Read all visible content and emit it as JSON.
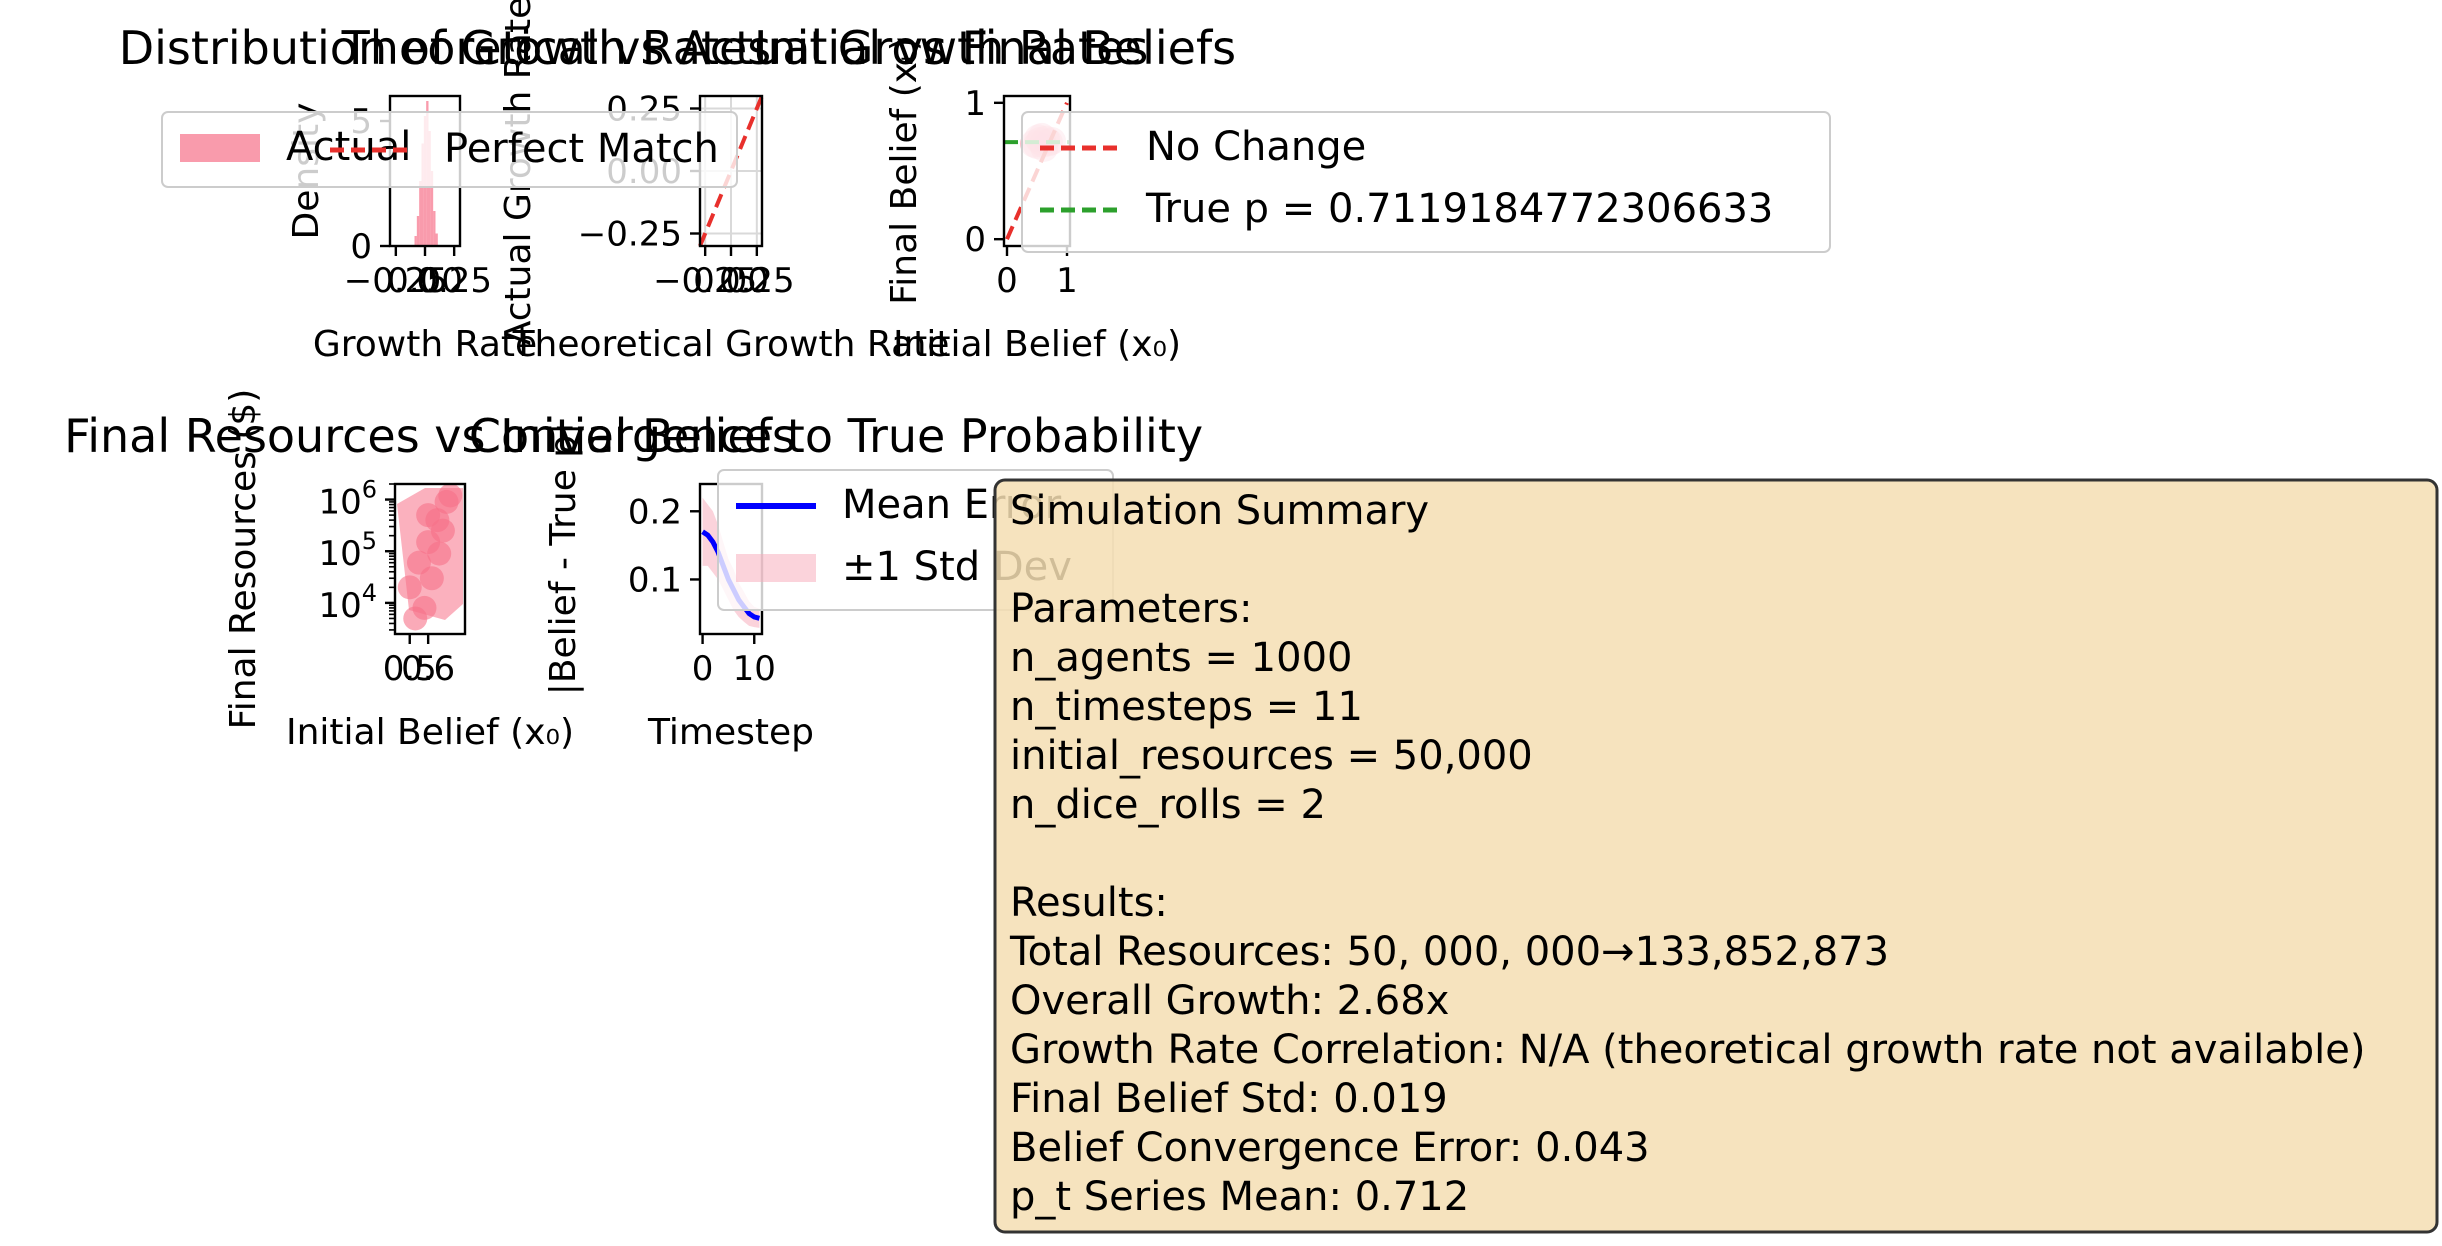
{
  "chart_data": [
    {
      "type": "bar",
      "subtype": "histogram",
      "title": "Distribution of Growth Rates",
      "xlabel": "Growth Rate",
      "ylabel": "Density",
      "xlim": [
        -0.3,
        0.3
      ],
      "ylim": [
        0,
        6
      ],
      "xticks": [
        -0.25,
        0.0,
        0.25
      ],
      "xtick_labels": [
        "−0.25",
        "0.00",
        "0.25"
      ],
      "yticks": [
        0,
        5
      ],
      "ytick_labels": [
        "0",
        "5"
      ],
      "color": "#f77189",
      "bin_centers": [
        -0.08,
        -0.06,
        -0.04,
        -0.02,
        0.0,
        0.02,
        0.04,
        0.06,
        0.08,
        0.1
      ],
      "values": [
        0.4,
        1.2,
        2.6,
        4.1,
        5.2,
        5.8,
        4.6,
        3.0,
        1.4,
        0.5
      ],
      "legend_entries": [
        "Actual"
      ],
      "legend_placement": "upper left"
    },
    {
      "type": "line",
      "title": "Theoretical vs Actual Growth Rates",
      "xlabel": "Theoretical Growth Rate",
      "ylabel": "Actual Growth Rate",
      "xlim": [
        -0.3,
        0.3
      ],
      "ylim": [
        -0.3,
        0.3
      ],
      "xticks": [
        -0.25,
        0.0,
        0.25
      ],
      "xtick_labels": [
        "−0.25",
        "0.00",
        "0.25"
      ],
      "yticks": [
        -0.25,
        0.0,
        0.25
      ],
      "ytick_labels": [
        "−0.25",
        "0.00",
        "0.25"
      ],
      "grid": true,
      "series": [
        {
          "name": "Perfect Match",
          "style": "dashed",
          "color": "#e8302c",
          "x": [
            -0.3,
            0.3
          ],
          "y": [
            -0.3,
            0.3
          ]
        }
      ],
      "legend_placement": "upper left"
    },
    {
      "type": "scatter",
      "title": "Initial vs Final Beliefs",
      "xlabel": "Initial Belief (x₀)",
      "ylabel": "Final Belief (xₜ)",
      "xlim": [
        -0.05,
        1.05
      ],
      "ylim": [
        -0.05,
        1.05
      ],
      "xticks": [
        0,
        1
      ],
      "xtick_labels": [
        "0",
        "1"
      ],
      "yticks": [
        0,
        1
      ],
      "ytick_labels": [
        "0",
        "1"
      ],
      "scatter_color": "#f77189",
      "scatter_points": [
        [
          0.45,
          0.7
        ],
        [
          0.5,
          0.69
        ],
        [
          0.55,
          0.72
        ],
        [
          0.6,
          0.7
        ],
        [
          0.65,
          0.73
        ],
        [
          0.7,
          0.71
        ],
        [
          0.75,
          0.72
        ],
        [
          0.52,
          0.74
        ],
        [
          0.62,
          0.67
        ],
        [
          0.58,
          0.75
        ]
      ],
      "series": [
        {
          "name": "No Change",
          "style": "dashed",
          "color": "#e8302c",
          "x": [
            0,
            1
          ],
          "y": [
            0,
            1
          ]
        },
        {
          "name": "True p = 0.7119184772306633",
          "style": "dashed",
          "color": "#2ca02c",
          "x": [
            -0.05,
            1.05
          ],
          "y": [
            0.7119,
            0.7119
          ]
        }
      ],
      "legend_placement": "upper right"
    },
    {
      "type": "scatter",
      "title": "Final Resources vs Initial Beliefs",
      "xlabel": "Initial Belief (x₀)",
      "ylabel": "Final Resources ($)",
      "yscale": "log",
      "xlim": [
        0.42,
        0.8
      ],
      "ylim": [
        2500,
        2000000
      ],
      "xticks": [
        0.5,
        0.6
      ],
      "xtick_labels": [
        "0.5",
        "0.6"
      ],
      "yticks": [
        10000,
        100000,
        1000000
      ],
      "ytick_labels": [
        "10",
        "10",
        "10"
      ],
      "ytick_exponents": [
        "4",
        "5",
        "6"
      ],
      "color": "#f77189",
      "points": [
        [
          0.5,
          20000
        ],
        [
          0.55,
          60000
        ],
        [
          0.6,
          150000
        ],
        [
          0.65,
          400000
        ],
        [
          0.7,
          900000
        ],
        [
          0.58,
          8000
        ],
        [
          0.62,
          30000
        ],
        [
          0.68,
          250000
        ],
        [
          0.53,
          5000
        ],
        [
          0.72,
          1200000
        ],
        [
          0.66,
          90000
        ],
        [
          0.6,
          500000
        ]
      ]
    },
    {
      "type": "line",
      "title": "Convergence to True Probability",
      "xlabel": "Timestep",
      "ylabel": "|Belief - True p|",
      "xlim": [
        -0.5,
        11.5
      ],
      "ylim": [
        0.02,
        0.24
      ],
      "xticks": [
        0,
        10
      ],
      "xtick_labels": [
        "0",
        "10"
      ],
      "yticks": [
        0.1,
        0.2
      ],
      "ytick_labels": [
        "0.1",
        "0.2"
      ],
      "x": [
        0,
        1,
        2,
        3,
        4,
        5,
        6,
        7,
        8,
        9,
        10,
        11
      ],
      "series": [
        {
          "name": "Mean Error",
          "color": "#0000ff",
          "values": [
            0.17,
            0.165,
            0.155,
            0.14,
            0.12,
            0.1,
            0.085,
            0.07,
            0.06,
            0.05,
            0.045,
            0.043
          ]
        },
        {
          "name": "±1 Std Dev",
          "type": "band",
          "color": "#f7a8b8",
          "lower": [
            0.12,
            0.12,
            0.11,
            0.1,
            0.085,
            0.07,
            0.055,
            0.045,
            0.038,
            0.032,
            0.03,
            0.029
          ],
          "upper": [
            0.22,
            0.21,
            0.2,
            0.18,
            0.155,
            0.13,
            0.115,
            0.095,
            0.082,
            0.068,
            0.06,
            0.057
          ]
        }
      ],
      "legend_placement": "upper right"
    }
  ],
  "summary_box": {
    "lines": [
      "Simulation Summary",
      "",
      "Parameters:",
      "n_agents = 1000",
      "n_timesteps = 11",
      "initial_resources = 50,000",
      "n_dice_rolls = 2",
      "",
      "Results:",
      "Total Resources: 50, 000, 000→133,852,873",
      "Overall Growth: 2.68x",
      "Growth Rate Correlation: N/A (theoretical growth rate not available)",
      "Final Belief Std: 0.019",
      "Belief Convergence Error: 0.043",
      "p_t Series Mean: 0.712"
    ],
    "background": "#f5deb3",
    "border": "#333333"
  }
}
